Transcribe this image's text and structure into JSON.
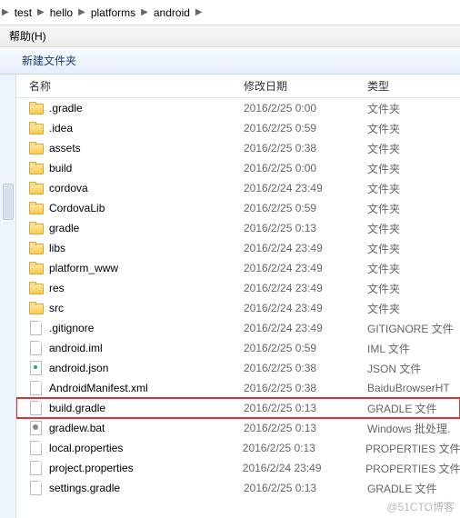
{
  "breadcrumbs": [
    "test",
    "hello",
    "platforms",
    "android"
  ],
  "menu": {
    "help": "帮助(H)"
  },
  "toolbar": {
    "new_folder": "新建文件夹"
  },
  "columns": {
    "name": "名称",
    "date": "修改日期",
    "type": "类型"
  },
  "rows": [
    {
      "icon": "folder",
      "name": ".gradle",
      "date": "2016/2/25 0:00",
      "type": "文件夹",
      "hl": false
    },
    {
      "icon": "folder",
      "name": ".idea",
      "date": "2016/2/25 0:59",
      "type": "文件夹",
      "hl": false
    },
    {
      "icon": "folder",
      "name": "assets",
      "date": "2016/2/25 0:38",
      "type": "文件夹",
      "hl": false
    },
    {
      "icon": "folder",
      "name": "build",
      "date": "2016/2/25 0:00",
      "type": "文件夹",
      "hl": false
    },
    {
      "icon": "folder",
      "name": "cordova",
      "date": "2016/2/24 23:49",
      "type": "文件夹",
      "hl": false
    },
    {
      "icon": "folder",
      "name": "CordovaLib",
      "date": "2016/2/25 0:59",
      "type": "文件夹",
      "hl": false
    },
    {
      "icon": "folder",
      "name": "gradle",
      "date": "2016/2/25 0:13",
      "type": "文件夹",
      "hl": false
    },
    {
      "icon": "folder",
      "name": "libs",
      "date": "2016/2/24 23:49",
      "type": "文件夹",
      "hl": false
    },
    {
      "icon": "folder",
      "name": "platform_www",
      "date": "2016/2/24 23:49",
      "type": "文件夹",
      "hl": false
    },
    {
      "icon": "folder",
      "name": "res",
      "date": "2016/2/24 23:49",
      "type": "文件夹",
      "hl": false
    },
    {
      "icon": "folder",
      "name": "src",
      "date": "2016/2/24 23:49",
      "type": "文件夹",
      "hl": false
    },
    {
      "icon": "file",
      "name": ".gitignore",
      "date": "2016/2/24 23:49",
      "type": "GITIGNORE 文件",
      "hl": false
    },
    {
      "icon": "file",
      "name": "android.iml",
      "date": "2016/2/25 0:59",
      "type": "IML 文件",
      "hl": false
    },
    {
      "icon": "json",
      "name": "android.json",
      "date": "2016/2/25 0:38",
      "type": "JSON 文件",
      "hl": false
    },
    {
      "icon": "file",
      "name": "AndroidManifest.xml",
      "date": "2016/2/25 0:38",
      "type": "BaiduBrowserHT",
      "hl": false
    },
    {
      "icon": "file",
      "name": "build.gradle",
      "date": "2016/2/25 0:13",
      "type": "GRADLE 文件",
      "hl": true
    },
    {
      "icon": "bat",
      "name": "gradlew.bat",
      "date": "2016/2/25 0:13",
      "type": "Windows 批处理.",
      "hl": false
    },
    {
      "icon": "file",
      "name": "local.properties",
      "date": "2016/2/25 0:13",
      "type": "PROPERTIES 文件",
      "hl": false
    },
    {
      "icon": "file",
      "name": "project.properties",
      "date": "2016/2/24 23:49",
      "type": "PROPERTIES 文件",
      "hl": false
    },
    {
      "icon": "file",
      "name": "settings.gradle",
      "date": "2016/2/25 0:13",
      "type": "GRADLE 文件",
      "hl": false
    }
  ],
  "watermark": "@51CTO博客"
}
